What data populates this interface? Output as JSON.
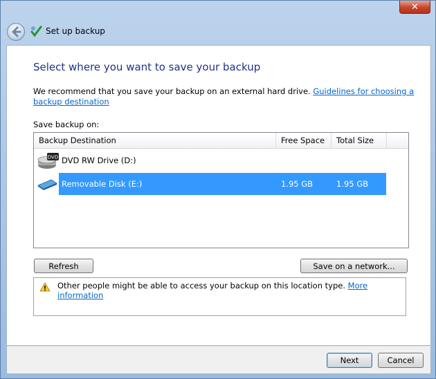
{
  "window": {
    "title": "Set up backup",
    "close_symbol": "✕"
  },
  "page": {
    "heading": "Select where you want to save your backup",
    "recommend_text": "We recommend that you save your backup on an external hard drive. ",
    "guidelines_link": "Guidelines for choosing a backup destination",
    "save_on_label": "Save backup on:"
  },
  "list": {
    "columns": [
      "Backup Destination",
      "Free Space",
      "Total Size"
    ],
    "rows": [
      {
        "name": "DVD RW Drive (D:)",
        "free": "",
        "total": "",
        "icon": "dvd-drive-icon",
        "selected": false
      },
      {
        "name": "Removable Disk (E:)",
        "free": "1.95 GB",
        "total": "1.95 GB",
        "icon": "removable-disk-icon",
        "selected": true
      }
    ]
  },
  "buttons": {
    "refresh": "Refresh",
    "save_network": "Save on a network...",
    "next": "Next",
    "cancel": "Cancel"
  },
  "warning": {
    "icon": "warning-icon",
    "text": "Other people might be able to access your backup on this location type. ",
    "link": "More information"
  },
  "colors": {
    "selection": "#3399ff",
    "heading": "#1e3287",
    "link": "#0066cc"
  }
}
